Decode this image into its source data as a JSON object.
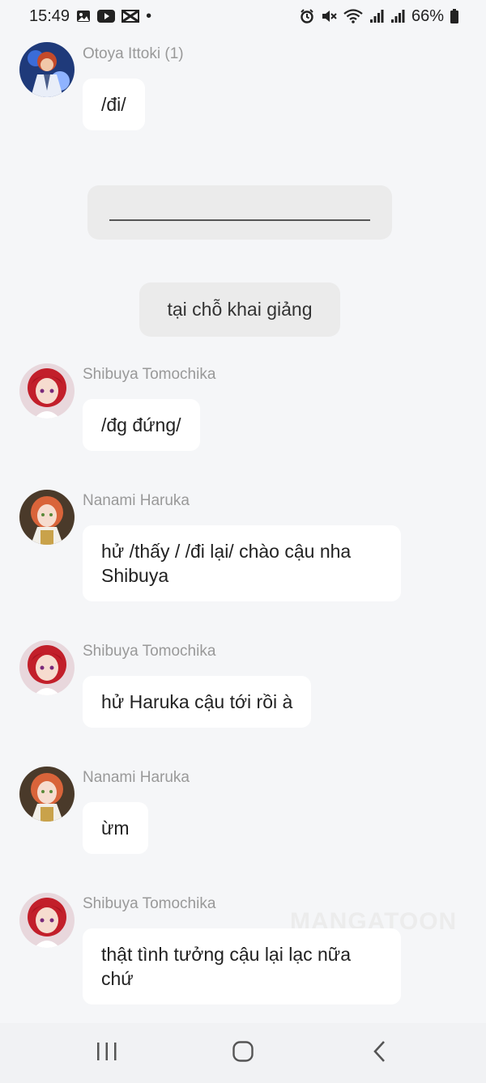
{
  "status_bar": {
    "time": "15:49",
    "dot": "•",
    "battery": "66%",
    "left_icons": [
      "gallery-icon",
      "youtube-icon",
      "capcut-icon"
    ],
    "right_icons": [
      "alarm-icon",
      "mute-icon",
      "wifi-icon",
      "signal-icon",
      "signal-icon",
      "battery-icon"
    ]
  },
  "messages": [
    {
      "type": "message",
      "sender": "Otoya Ittoki (1)",
      "text": "/đi/"
    },
    {
      "type": "system-blank",
      "text": ""
    },
    {
      "type": "system",
      "text": "tại chỗ khai giảng"
    },
    {
      "type": "message",
      "sender": "Shibuya Tomochika",
      "text": "/đg đứng/"
    },
    {
      "type": "message",
      "sender": "Nanami Haruka",
      "text": "hử /thấy / /đi lại/ chào cậu nha Shibuya"
    },
    {
      "type": "message",
      "sender": "Shibuya Tomochika",
      "text": "hử Haruka cậu tới rồi à"
    },
    {
      "type": "message",
      "sender": "Nanami Haruka",
      "text": "ừm"
    },
    {
      "type": "message",
      "sender": "Shibuya Tomochika",
      "text": "thật tình tưởng cậu lại lạc nữa chứ"
    }
  ],
  "watermark": "MANGATOON",
  "nav_bar": {
    "buttons": [
      "recent-apps-icon",
      "home-icon",
      "back-icon"
    ]
  },
  "colors": {
    "background": "#f5f6f8",
    "bubble": "#ffffff",
    "system_pill": "#ebebeb",
    "sender_text": "#999999"
  }
}
